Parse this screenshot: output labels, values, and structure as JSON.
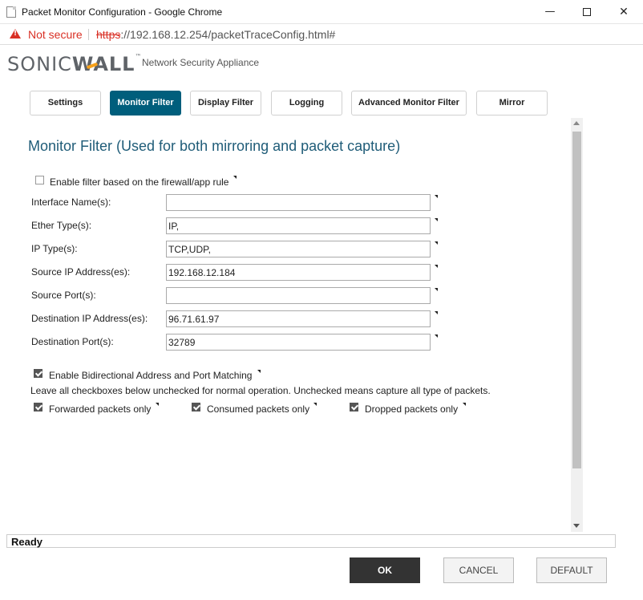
{
  "window": {
    "title": "Packet Monitor Configuration - Google Chrome",
    "minimize": "—",
    "close": "✕"
  },
  "address_bar": {
    "security_label": "Not secure",
    "url_protocol": "https",
    "url_rest": "://192.168.12.254/packetTraceConfig.html#"
  },
  "header": {
    "logo_part1": "SONIC",
    "logo_part2": "WALL",
    "logo_tm": "™",
    "subtitle": "Network Security Appliance"
  },
  "tabs": [
    {
      "label": "Settings",
      "active": false
    },
    {
      "label": "Monitor Filter",
      "active": true
    },
    {
      "label": "Display Filter",
      "active": false
    },
    {
      "label": "Logging",
      "active": false
    },
    {
      "label": "Advanced Monitor Filter",
      "active": false
    },
    {
      "label": "Mirror",
      "active": false
    }
  ],
  "section": {
    "title": "Monitor Filter (Used for both mirroring and packet capture)"
  },
  "enable_filter": {
    "label": "Enable filter based on the firewall/app rule",
    "checked": false
  },
  "fields": [
    {
      "label": "Interface Name(s):",
      "value": ""
    },
    {
      "label": "Ether Type(s):",
      "value": "IP,"
    },
    {
      "label": "IP Type(s):",
      "value": "TCP,UDP,"
    },
    {
      "label": "Source IP Address(es):",
      "value": "192.168.12.184"
    },
    {
      "label": "Source Port(s):",
      "value": ""
    },
    {
      "label": "Destination IP Address(es):",
      "value": "96.71.61.97"
    },
    {
      "label": "Destination Port(s):",
      "value": "32789"
    }
  ],
  "bidirectional": {
    "label": "Enable Bidirectional Address and Port Matching",
    "checked": true
  },
  "note": "Leave all checkboxes below unchecked for normal operation. Unchecked means capture all type of packets.",
  "packet_options": [
    {
      "label": "Forwarded packets only",
      "checked": true
    },
    {
      "label": "Consumed packets only",
      "checked": true
    },
    {
      "label": "Dropped packets only",
      "checked": true
    }
  ],
  "status": "Ready",
  "buttons": {
    "ok": "OK",
    "cancel": "CANCEL",
    "default": "DEFAULT"
  },
  "colors": {
    "accent": "#005e7c",
    "title_color": "#1f5c78",
    "warning": "#d93025"
  }
}
